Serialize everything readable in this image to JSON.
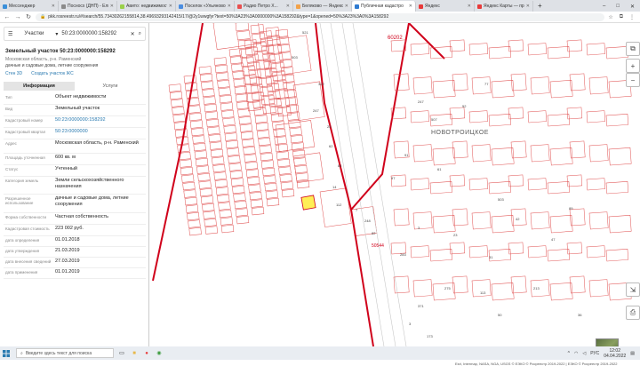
{
  "browser": {
    "tabs": [
      {
        "title": "Мессенджер",
        "color": "#3a8fd9"
      },
      {
        "title": "Посносх (ДНП) - Ели",
        "color": "#8a8a8a"
      },
      {
        "title": "Авито: недвижимость",
        "color": "#9ad04a"
      },
      {
        "title": "Поселок «Ульяново»",
        "color": "#4a8de0"
      },
      {
        "title": "Радио Петро Х...",
        "color": "#e94f4f"
      },
      {
        "title": "Беляково — Яндекс",
        "color": "#f2a24a"
      },
      {
        "title": "Публичная кадастро",
        "color": "#2f7bd1",
        "active": true
      },
      {
        "title": "Яндекс",
        "color": "#e83a3a"
      },
      {
        "title": "Яндекс Карты — пр",
        "color": "#e83a3a"
      }
    ],
    "new_tab": "+",
    "url": "pkk.rosreestr.ru/#/search/55.73430262155814,38.49693293142415/17/@2y1wwgfyr?text=50%3A23%3A0000000%3A158292&type=1&opened=50%3A23%3A0%3A158292",
    "icons": [
      "back-icon",
      "forward-icon",
      "reload-icon",
      "lock-icon",
      "star-icon",
      "extensions-icon",
      "menu-icon"
    ]
  },
  "panel": {
    "search_type": "Участки",
    "search_query": "50:23:0000000:158292",
    "title": "Земельный участок 50:23:0000000:158292",
    "address_short": "Московская область, р-н. Раменский",
    "use": "дачные и садовые дома, летние сооружения",
    "link_3d": "Стен 3D",
    "link_egrn": "Создать участок ЖС",
    "tabs": [
      "Информация",
      "Услуги"
    ],
    "rows": [
      {
        "key": "Тип",
        "value": "Объект недвижимости"
      },
      {
        "key": "Вид",
        "value": "Земельный участок"
      },
      {
        "key": "Кадастровый номер",
        "value": "50:23:0000000:158292",
        "link": true
      },
      {
        "key": "Кадастровый квартал",
        "value": "50:23:0000000",
        "link": true
      },
      {
        "key": "Адрес",
        "value": "Московская область, р-н. Раменский"
      },
      {
        "key": "Площадь уточненная",
        "value": "600 кв. м"
      },
      {
        "key": "Статус",
        "value": "Учтенный"
      },
      {
        "key": "Категория земель",
        "value": "Земли сельскохозяйственного назначения"
      },
      {
        "key": "Разрешенное использование",
        "value": "дачные и садовые дома, летние сооружения"
      },
      {
        "key": "Форма собственности",
        "value": "Частная собственность"
      },
      {
        "key": "Кадастровая стоимость",
        "value": "223 002 руб."
      },
      {
        "key": "дата определения",
        "value": "01.01.2018"
      },
      {
        "key": "дата утверждения",
        "value": "21.03.2019"
      },
      {
        "key": "дата внесения сведений",
        "value": "27.03.2019"
      },
      {
        "key": "дата применения",
        "value": "01.01.2019"
      }
    ]
  },
  "map": {
    "labels": [
      {
        "text": "НОВОТРОИЦКОЕ"
      },
      {
        "text": "60202"
      },
      {
        "text": "50544"
      }
    ],
    "parcel_numbers": [
      "521",
      "503",
      "322",
      "247",
      "25",
      "62",
      "84",
      "14",
      "112",
      "7",
      "248",
      "82",
      "97",
      "91",
      "247",
      "52",
      "507",
      "61",
      "77",
      "503",
      "3",
      "23",
      "283",
      "31",
      "275",
      "113",
      "371",
      "3",
      "173",
      "42",
      "213",
      "47",
      "89",
      "36",
      "50"
    ],
    "attribution": "Esri, Intermap, NASA, NGA, USGS © ЕЭКО © Росреестр 2019-2022 | ЕЭКО © Росреестр 2019-2022",
    "scale": "40 м"
  },
  "taskbar": {
    "search_placeholder": "Введите здесь текст для поиска",
    "lang": "РУС",
    "time": "12:02",
    "date": "04.04.2022"
  },
  "colors": {
    "accent": "#2a7ab0",
    "boundary": "#d0021b",
    "selected_parcel": "#ffee55"
  }
}
